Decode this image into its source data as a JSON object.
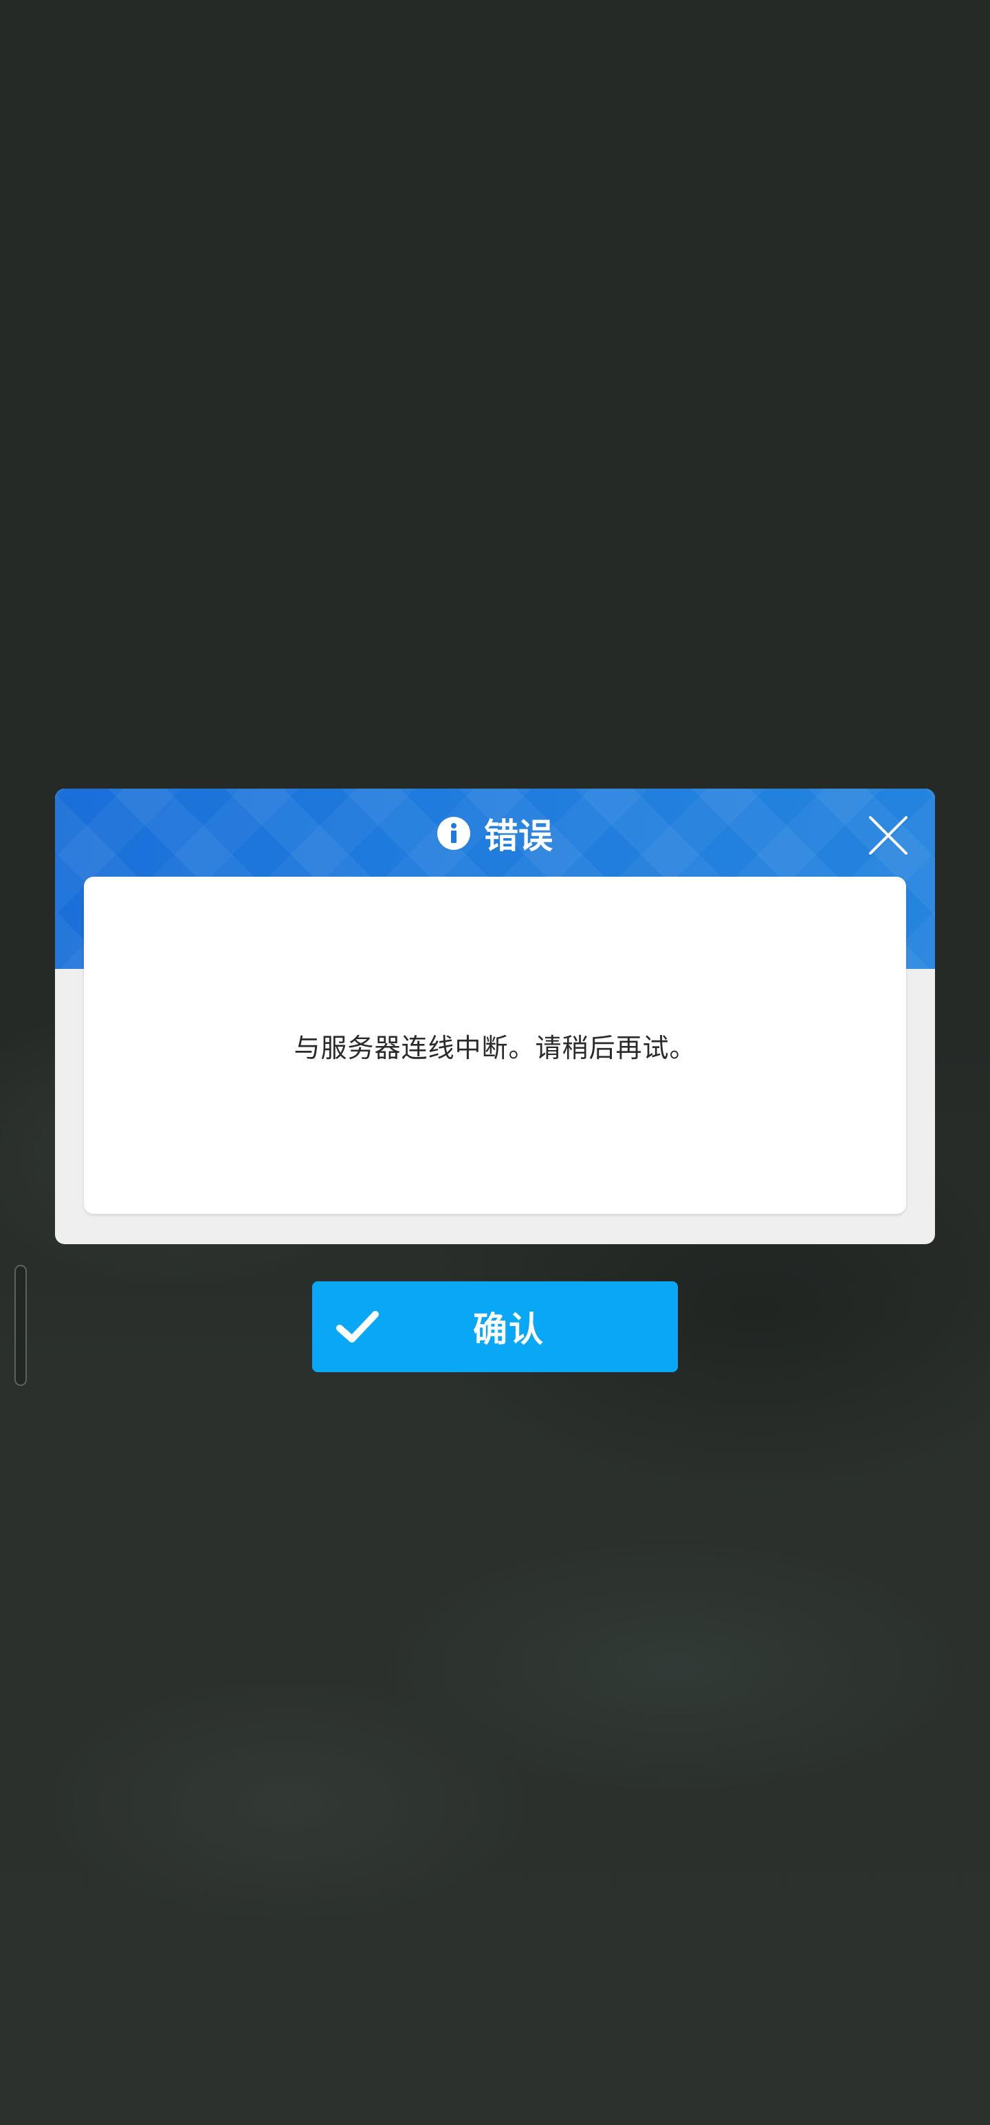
{
  "dialog": {
    "title": "错误",
    "message": "与服务器连线中断。请稍后再试。",
    "confirm_label": "确认"
  },
  "icons": {
    "title_icon": "info-icon",
    "close_icon": "close-icon",
    "confirm_icon": "checkmark-icon"
  },
  "colors": {
    "header_blue": "#1f7bdd",
    "confirm_blue": "#08a8f6",
    "backdrop": "#262a27"
  }
}
